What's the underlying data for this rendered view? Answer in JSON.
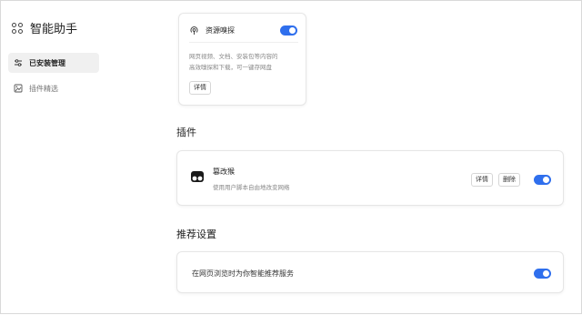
{
  "sidebar": {
    "brand_title": "智能助手",
    "items": [
      {
        "label": "已安装管理",
        "active": true
      },
      {
        "label": "插件精选",
        "active": false
      }
    ]
  },
  "resource_card": {
    "title": "资源嗅探",
    "enabled": true,
    "description_line1": "网页视频、文档、安装包等内容的",
    "description_line2": "高效嗅探和下载，可一键存网盘",
    "details_label": "详情"
  },
  "plugins_section": {
    "title": "插件",
    "items": [
      {
        "name": "篡改猴",
        "description": "使用用户脚本自由地改变网络",
        "details_label": "详情",
        "delete_label": "删除",
        "enabled": true
      }
    ]
  },
  "recommend_section": {
    "title": "推荐设置",
    "option_label": "在网页浏览时为你智能推荐服务",
    "enabled": true
  },
  "colors": {
    "accent": "#2f6fed",
    "active_nav_bg": "#f0f0f0"
  }
}
